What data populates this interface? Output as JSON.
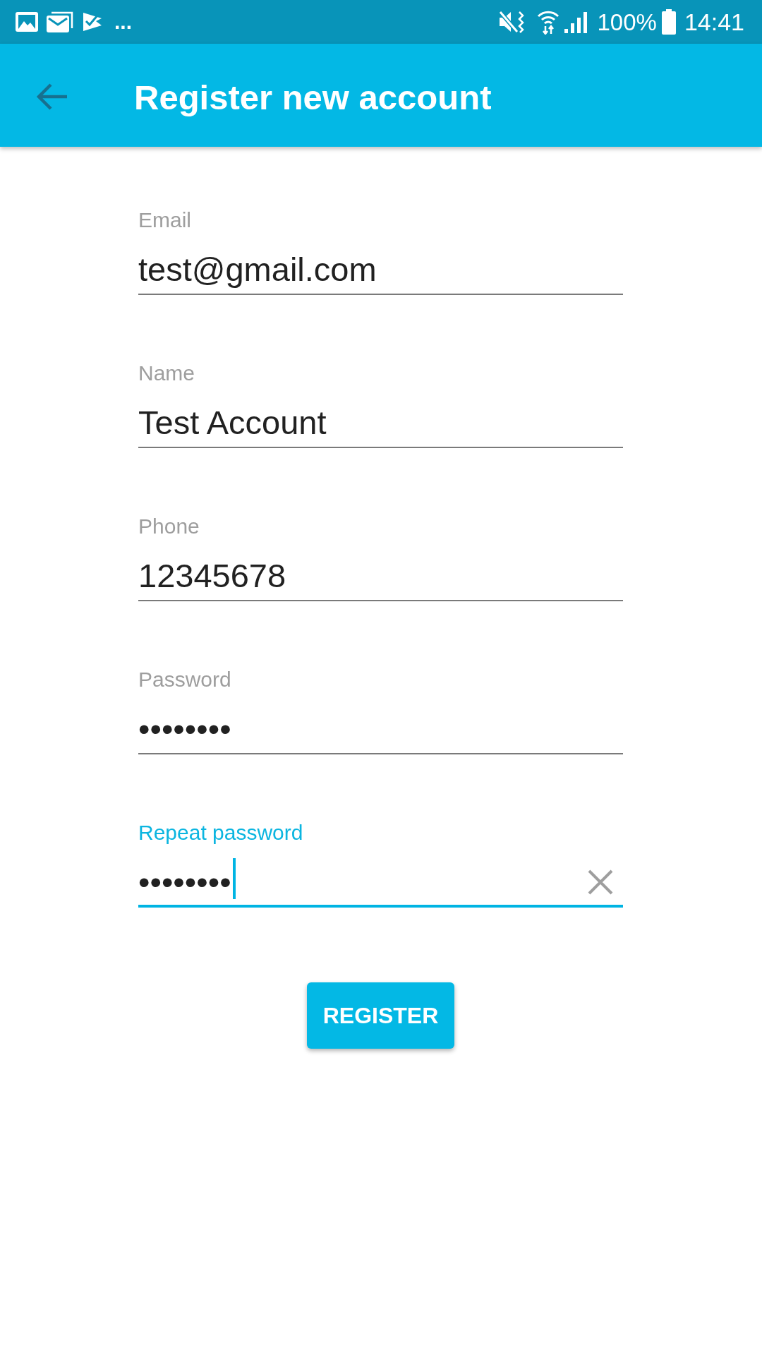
{
  "status_bar": {
    "more_notifications": "...",
    "battery_text": "100%",
    "time": "14:41"
  },
  "app_bar": {
    "title": "Register new account"
  },
  "form": {
    "fields": [
      {
        "label": "Email",
        "value": "test@gmail.com",
        "focused": false
      },
      {
        "label": "Name",
        "value": "Test Account",
        "focused": false
      },
      {
        "label": "Phone",
        "value": "12345678",
        "focused": false
      },
      {
        "label": "Password",
        "value": "••••••••",
        "focused": false
      },
      {
        "label": "Repeat password",
        "value": "••••••••",
        "focused": true
      }
    ],
    "submit_button": "REGISTER"
  }
}
